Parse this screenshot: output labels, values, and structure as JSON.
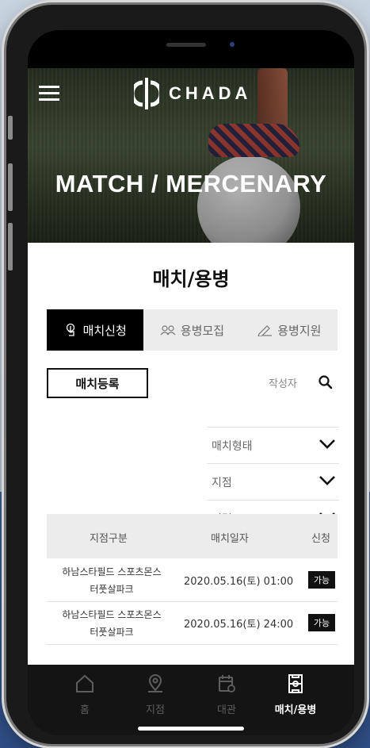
{
  "header": {
    "logo_text": "CHADA",
    "hero_title": "MATCH / MERCENARY"
  },
  "main": {
    "page_title": "매치/용병",
    "tabs": [
      {
        "label": "매치신청",
        "icon": "touch-icon",
        "active": true
      },
      {
        "label": "용병모집",
        "icon": "people-icon",
        "active": false
      },
      {
        "label": "용병지원",
        "icon": "pen-icon",
        "active": false
      }
    ],
    "register_label": "매치등록",
    "search_placeholder": "작성자",
    "filters": [
      {
        "label": "매치형태"
      },
      {
        "label": "지점"
      },
      {
        "label": "정렬"
      }
    ],
    "table": {
      "headers": [
        "지점구분",
        "매치일자",
        "신청"
      ],
      "rows": [
        {
          "branch_line1": "하남스타필드 스포츠몬스",
          "branch_line2": "터풋살파크",
          "date": "2020.05.16(토) 01:00",
          "status": "가능"
        },
        {
          "branch_line1": "하남스타필드 스포츠몬스",
          "branch_line2": "터풋살파크",
          "date": "2020.05.16(토) 24:00",
          "status": "가능"
        }
      ]
    }
  },
  "bottom_nav": [
    {
      "label": "홈",
      "icon": "home-icon",
      "active": false
    },
    {
      "label": "지점",
      "icon": "location-pin-icon",
      "active": false
    },
    {
      "label": "대관",
      "icon": "calendar-icon",
      "active": false
    },
    {
      "label": "매치/용병",
      "icon": "soccer-field-icon",
      "active": true
    }
  ],
  "colors": {
    "accent": "#000000",
    "tab_bg": "#ececec",
    "nav_bg": "#141414",
    "nav_inactive": "#5e5e5e"
  }
}
